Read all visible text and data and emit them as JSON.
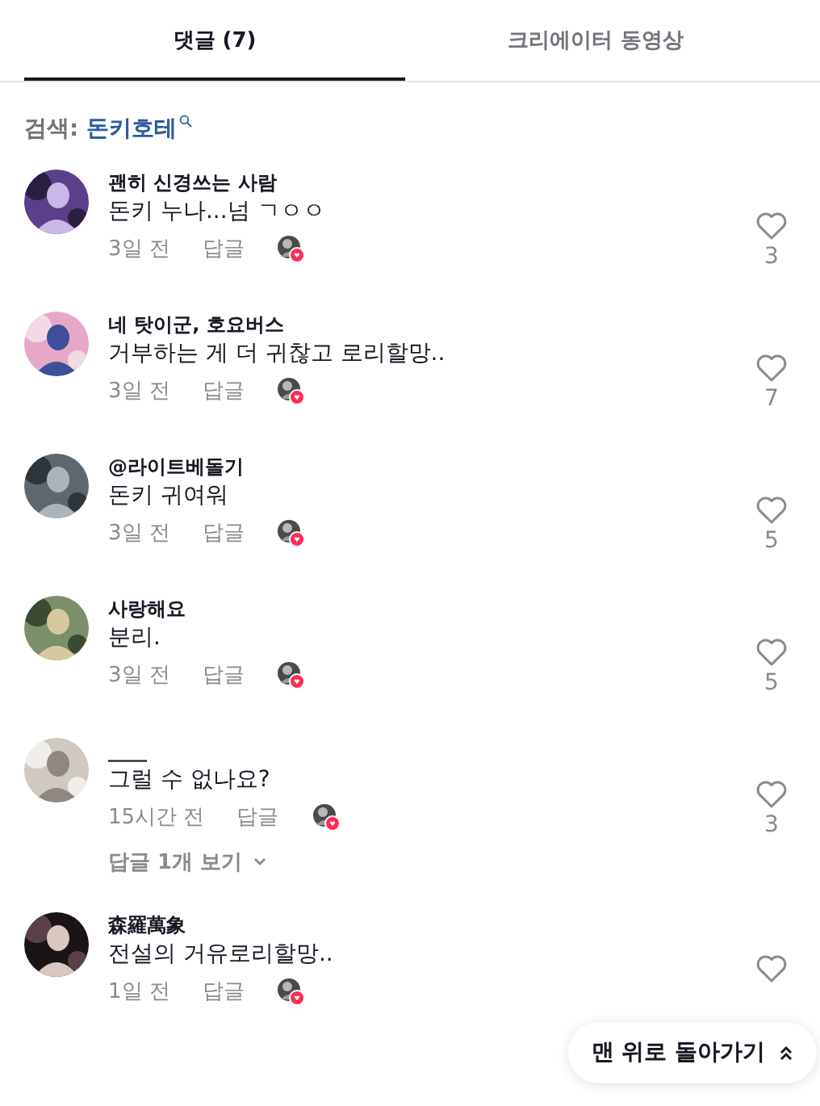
{
  "tabs": [
    {
      "label": "댓글 (7)",
      "selected": true
    },
    {
      "label": "크리에이터 동영상",
      "selected": false
    }
  ],
  "search": {
    "label": "검색:",
    "term": "돈키호테"
  },
  "comments": [
    {
      "author": "괜히 신경쓰는 사람",
      "text": "돈키 누나...넘 ㄱㅇㅇ",
      "time": "3일 전",
      "reply": "답글",
      "creator_liked": true,
      "likes": "3"
    },
    {
      "author": "네 탓이군, 호요버스",
      "text": "거부하는 게 더 귀찮고 로리할망..",
      "time": "3일 전",
      "reply": "답글",
      "creator_liked": true,
      "likes": "7"
    },
    {
      "author": "@라이트베돌기",
      "text": "돈키 귀여워",
      "time": "3일 전",
      "reply": "답글",
      "creator_liked": true,
      "likes": "5"
    },
    {
      "author": "사랑해요",
      "text": "분리.",
      "time": "3일 전",
      "reply": "답글",
      "creator_liked": true,
      "likes": "5"
    },
    {
      "author": "____",
      "text": "그럴 수 없나요?",
      "time": "15시간 전",
      "reply": "답글",
      "creator_liked": true,
      "likes": "3",
      "replies": "답글 1개 보기"
    },
    {
      "author": "森羅萬象",
      "text": "전설의 거유로리할망..",
      "time": "1일 전",
      "reply": "답글",
      "creator_liked": true
    }
  ],
  "back_to_top": "맨 위로 돌아가기"
}
